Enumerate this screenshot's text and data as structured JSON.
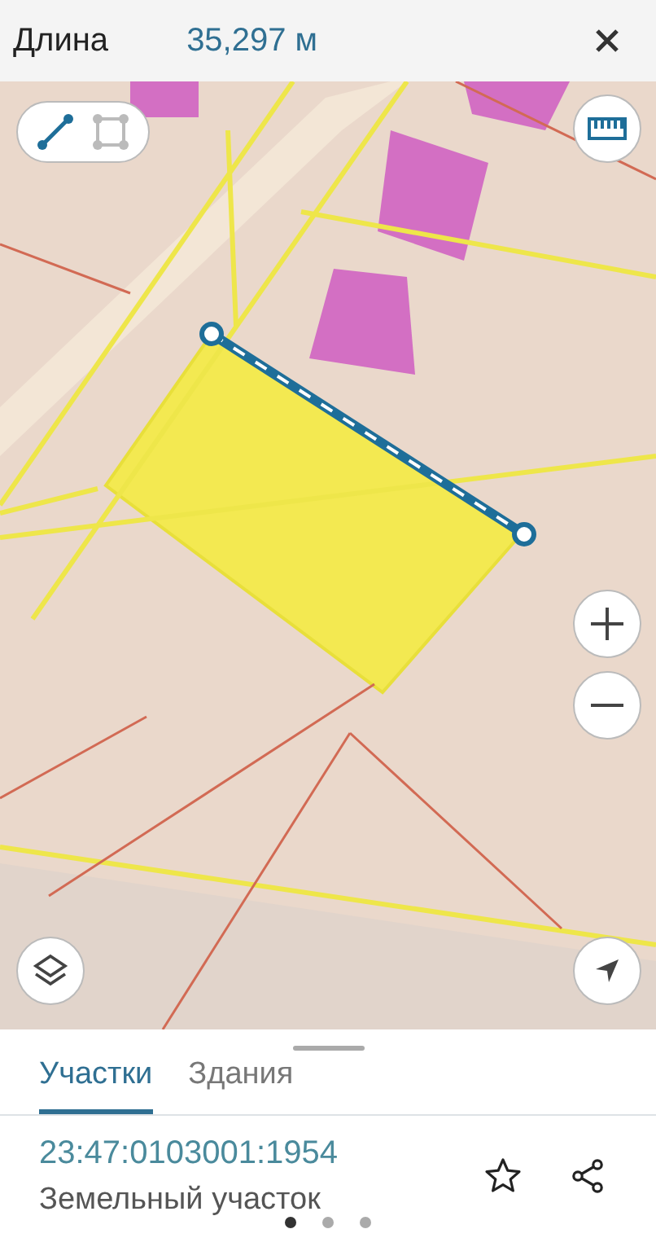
{
  "header": {
    "label": "Длина",
    "value": "35,297 м"
  },
  "measure_modes": [
    {
      "kind": "line",
      "selected": true
    },
    {
      "kind": "area",
      "selected": false
    }
  ],
  "tabs": [
    {
      "label": "Участки",
      "selected": true
    },
    {
      "label": "Здания",
      "selected": false
    }
  ],
  "result": {
    "number": "23:47:0103001:1954",
    "type": "Земельный участок",
    "favorite": false
  },
  "pager": [
    {
      "selected": true
    },
    {
      "selected": false
    },
    {
      "selected": false
    }
  ]
}
